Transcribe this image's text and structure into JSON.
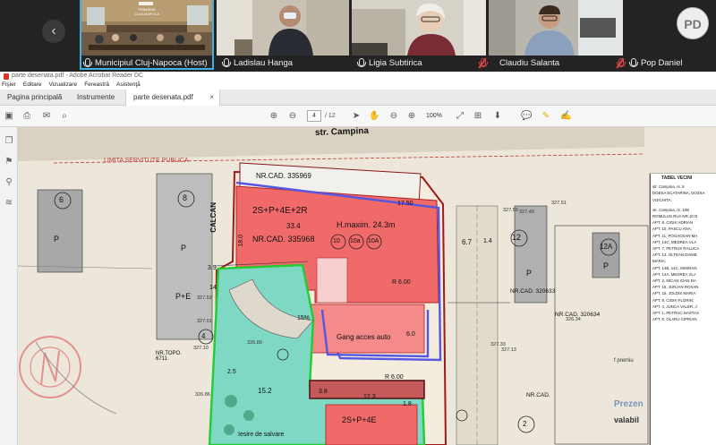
{
  "meeting": {
    "participants": [
      {
        "name": "Municipiul Cluj-Napoca (Host)",
        "muted": false
      },
      {
        "name": "Ladislau Hanga",
        "muted": false
      },
      {
        "name": "Ligia Subtirica",
        "muted": false
      },
      {
        "name": "Claudiu Salanta",
        "muted": true
      },
      {
        "name": "Pop Daniel",
        "muted": true
      }
    ],
    "host_room_sign": "PRIMĂRIA\nCLUJ-NAPOCA",
    "avatar_initials": "PD"
  },
  "app": {
    "window_title": "parte desenata.pdf - Adobe Acrobat Reader DC",
    "menu": [
      "Fişier",
      "Editare",
      "Vizualizare",
      "Fereastră",
      "Asistenţă"
    ],
    "tabs": {
      "home": "Pagina principală",
      "tools": "Instrumente",
      "document": "parte desenata.pdf"
    },
    "toolbar": {
      "page_current": "4",
      "page_total": "/ 12",
      "zoom": "100%"
    }
  },
  "plan": {
    "street": "str. Campina",
    "limit_label": "LIMITA SERVITUTE PUBLICA",
    "calcan": "CALCAN",
    "main_building": "2S+P+4E+2R",
    "main_cad": "NR.CAD. 335968",
    "top_cad": "NR.CAD. 335969",
    "hmax": "H.maxim. 24.3m",
    "lower_building": "2S+P+4E",
    "gang": "Gang acces auto",
    "radius": "R 6.00",
    "exit": "Iesire de salvare",
    "cad_right_1": "NR.CAD. 320633",
    "cad_right_2": "NR.CAD. 320634",
    "cad_bottom": "NR.CAD.",
    "topo": "NR.TOPO. 6711",
    "prezent": "Prezen",
    "valabil": "valabil",
    "premium": "f premiu",
    "hrp_units": [
      "10",
      "10a",
      "10A"
    ],
    "dims": [
      "33.4",
      "18.0",
      "3.9",
      "14",
      "6.7",
      "1.4",
      "15.2",
      "3.8",
      "12.3",
      "1.8",
      "6.0",
      "15%",
      "2.5",
      "17.50"
    ],
    "lots": [
      "8",
      "6",
      "12",
      "12A",
      "4",
      "2"
    ],
    "lot_p": "P",
    "lot_pe": "P+E",
    "elev": [
      "327.59",
      "327.51",
      "327.52",
      "327.01",
      "326.86",
      "327.33",
      "327.49",
      "327.13",
      "326.34",
      "326.80",
      "327.10"
    ],
    "legend": {
      "title": "TABEL VECINI",
      "lines": [
        "str. Campina, nr. 8",
        "DOESA ECATARINA; DOZSA",
        "VOICHITA;",
        "str. Campina, nr. 10B",
        "ROMULUS RUA NR.10 D",
        "APT. 8, CIGHI ADRIAN",
        "APT. 10, PASCU ANA;",
        "APT. 11, POGACEAN MA",
        "APT. 14C, MEDREA VLA",
        "APT. 7, PETRUS RALUCA",
        "APT. 13, OLTEAN DANIE",
        "MARIA;",
        "APT. 14B, 14C, MISIRAN",
        "APT. 14A, MEDREA VLA",
        "APT. 2, MICAN IOAN DA",
        "APT. 15, JURJAN ROXAN",
        "APT. 15, JOLDIS MARIA",
        "APT. 9, CIGHI FLORIN;",
        "APT. 4, JUNCA VALER, J",
        "APT. 1, PETRUC NASTAS",
        "APT. 6, OLARU CIPRIAN"
      ]
    }
  },
  "colors": {
    "accent": "#3fb0e0",
    "building": "#f06a6a",
    "green": "#22cc33",
    "path": "#5656e0",
    "boundary": "#a01818"
  }
}
